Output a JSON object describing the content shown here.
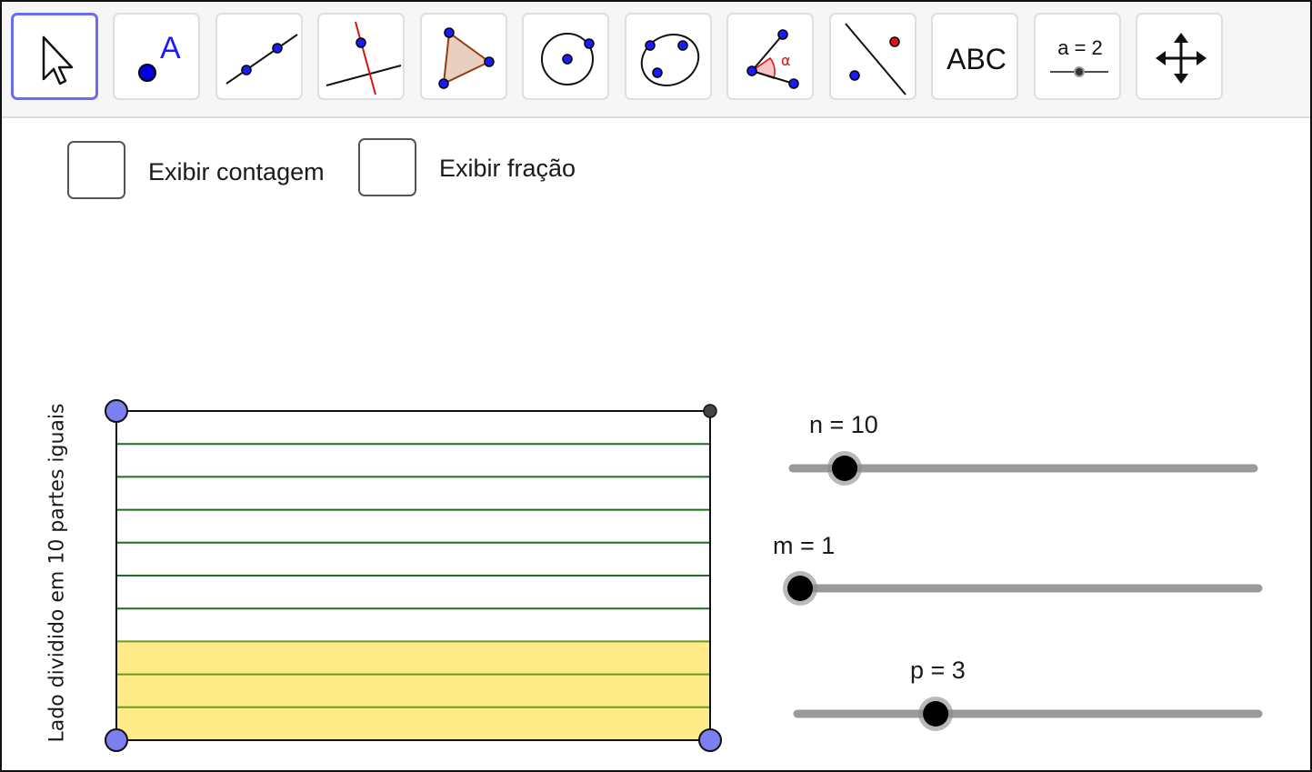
{
  "toolbar": {
    "tools": [
      {
        "name": "move-tool",
        "icon": "arrow-cursor-icon",
        "active": true
      },
      {
        "name": "point-tool",
        "icon": "point-icon",
        "label": "A"
      },
      {
        "name": "line-tool",
        "icon": "line-through-two-points-icon"
      },
      {
        "name": "perpendicular-line-tool",
        "icon": "perpendicular-line-icon"
      },
      {
        "name": "polygon-tool",
        "icon": "polygon-icon"
      },
      {
        "name": "circle-tool",
        "icon": "circle-center-point-icon"
      },
      {
        "name": "conic-tool",
        "icon": "ellipse-icon"
      },
      {
        "name": "angle-tool",
        "icon": "angle-icon",
        "label": "α"
      },
      {
        "name": "reflect-tool",
        "icon": "reflect-about-line-icon"
      },
      {
        "name": "text-tool",
        "icon": "text-icon",
        "label": "ABC"
      },
      {
        "name": "slider-tool",
        "icon": "slider-icon",
        "label": "a = 2"
      },
      {
        "name": "move-graphics-tool",
        "icon": "move-graphics-view-icon"
      }
    ]
  },
  "checkboxes": [
    {
      "label": "Exibir contagem",
      "checked": false
    },
    {
      "label": "Exibir fração",
      "checked": false
    }
  ],
  "sliders": {
    "n": {
      "label": "n = 10",
      "value": 10,
      "min": 1,
      "max": 100
    },
    "m": {
      "label": "m = 1",
      "value": 1,
      "min": 1,
      "max": 100
    },
    "p": {
      "label": "p = 3",
      "value": 3,
      "min": 0,
      "max": 10
    }
  },
  "figure": {
    "side_label": "Lado dividido em 10 partes iguais",
    "divisions": 10,
    "shaded_parts": 3,
    "colors": {
      "division_line": "#1e6e1e",
      "shaded_fill": "#ffeb88",
      "shaded_line": "#6a9a1e",
      "vertex_point": "#7b7ff0",
      "corner_point": "#444444",
      "accent": "#6a6cf6"
    }
  }
}
